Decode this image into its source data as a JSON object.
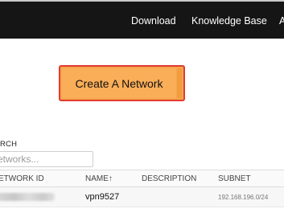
{
  "nav": {
    "links": [
      "Download",
      "Knowledge Base",
      "A"
    ]
  },
  "cta": {
    "label": "Create A Network"
  },
  "search": {
    "label": "RCH",
    "placeholder": "etworks..."
  },
  "table": {
    "columns": [
      "ETWORK ID",
      "NAME↑",
      "DESCRIPTION",
      "SUBNET"
    ],
    "rows": [
      {
        "network_id": "",
        "name": "vpn9527",
        "description": "",
        "subnet": "192.168.196.0/24"
      }
    ]
  }
}
